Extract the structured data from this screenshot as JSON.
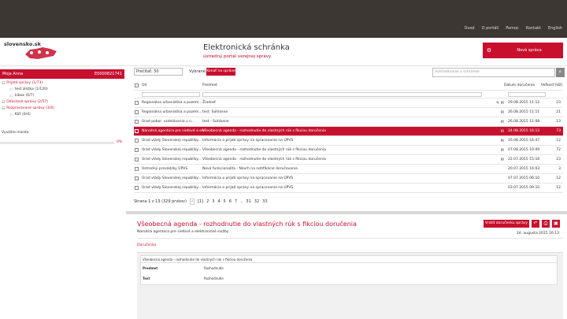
{
  "topnav": [
    "Úvod",
    "O portáli",
    "Pomoc",
    "Kontakt",
    "English"
  ],
  "header": {
    "logo": "slovensko.sk",
    "title": "Elektronická schránka",
    "subtitle": "ústredný portál verejnej správy",
    "new_message": "Nová správa"
  },
  "sidebar": {
    "owner": "Moja Anna",
    "id": "E0000821741",
    "tree": [
      {
        "label": "Prijaté správy (1/73)",
        "level": 0,
        "red": true
      },
      {
        "label": "test zložka (1/120)",
        "level": 1,
        "red": false
      },
      {
        "label": "Inbox (0/7)",
        "level": 1,
        "red": false
      },
      {
        "label": "Odoslané správy (2/57)",
        "level": 0,
        "red": true
      },
      {
        "label": "Rozpracované správy (3/4)",
        "level": 0,
        "red": true
      },
      {
        "label": "Kôš (0/4)",
        "level": 1,
        "red": false
      }
    ],
    "used_label": "Využitie miesta",
    "used_pct": "0%",
    "used_fraction": 0.0
  },
  "toolbar": {
    "folder": "Prečítať: 50",
    "selected_label": "Vybrané:",
    "action_button": "Konať na správe",
    "search_placeholder": "Vyhľadávanie v schránke"
  },
  "grid": {
    "headers": {
      "from": "Od",
      "subject": "Predmet",
      "date": "Dátum doručenia",
      "size": "Veľkosť [kB]"
    },
    "rows": [
      {
        "from": "Regionálna urbanistika a pozem...",
        "subject": "Žiadosť",
        "icon": "✎ ✉",
        "date": "29.08.2015 11:12",
        "size": "23",
        "sel": false
      },
      {
        "from": "Regionálna urbanistika a pozem...",
        "subject": "test: Súhlasne",
        "icon": "✉",
        "date": "26.08.2015 11:11",
        "size": "21",
        "sel": false
      },
      {
        "from": "Úrad pobor. vzdelávania v n...",
        "subject": "test - Súhlasne",
        "icon": "✉",
        "date": "26.08.2015 11:08",
        "size": "13",
        "sel": false
      },
      {
        "from": "Národná agentúra pre sieťové a ele...",
        "subject": "Všeobecná agenda - rozhodnutie do vlastných rúk s fikciou doručenia",
        "icon": "✉",
        "date": "24.08.2015 16:13",
        "size": "73",
        "sel": true
      },
      {
        "from": "Úrad vlády Slovenskej republiky...",
        "subject": "Informácia o prijatí správy na spracovanie na ÚPVS",
        "icon": "✉",
        "date": "16.08.2015 14:47",
        "size": "12",
        "sel": false
      },
      {
        "from": "Úrad vlády Slovenskej republiky...",
        "subject": "Všeobecná agenda - rozhodnutie do vlastných rúk s fikciou doručenia",
        "icon": "✉",
        "date": "07.08.2015 10:09",
        "size": "72",
        "sel": false
      },
      {
        "from": "Úrad vlády Slovenskej republiky...",
        "subject": "Všeobecná agenda - rozhodnutie do vlastných rúk s fikciou doručenia",
        "icon": "✉",
        "date": "22.07.2015 15:18",
        "size": "23",
        "sel": false
      },
      {
        "from": "Ústredný prevádzky ÚPVS",
        "subject": "Nová funkcionalita - Návrh na notifikácie doručovania",
        "icon": "",
        "date": "20.07.2015 16:03",
        "size": "3",
        "sel": false
      },
      {
        "from": "Úrad vlády Slovenskej republiky...",
        "subject": "Informácia o prijatí správy na spracovanie na ÚPVS",
        "icon": "",
        "date": "07.07.2015 06:10",
        "size": "12",
        "sel": false
      },
      {
        "from": "Úrad vlády Slovenskej republiky...",
        "subject": "Informácia o prijatí správy na spracovanie na ÚPVS",
        "icon": "",
        "date": "03.07.2015 09:10",
        "size": "12",
        "sel": false
      }
    ]
  },
  "pager": {
    "label": "Strana 1 z 13 (329 prvkov)",
    "pages": [
      "[1]",
      "2",
      "3",
      "4",
      "5",
      "6",
      "7",
      "..",
      "31",
      "32",
      "33"
    ]
  },
  "detail": {
    "title": "Všeobecná agenda - rozhodnutie do vlastných rúk s fikciou doručenia",
    "sender": "Národná agentúra pre sieťové a elektronické služby",
    "date": "24. augusta 2015 16:13",
    "action": "Vrátiť doručenku správy",
    "link": "Doručenka",
    "table_header": "Všeobecná agenda - rozhodnutie do vlastných rúk s fikciou doručenia",
    "rows": [
      {
        "k": "Predmet",
        "v": "Rozhodnutie"
      },
      {
        "k": "Text",
        "v": "Rozhodnutie"
      }
    ]
  }
}
